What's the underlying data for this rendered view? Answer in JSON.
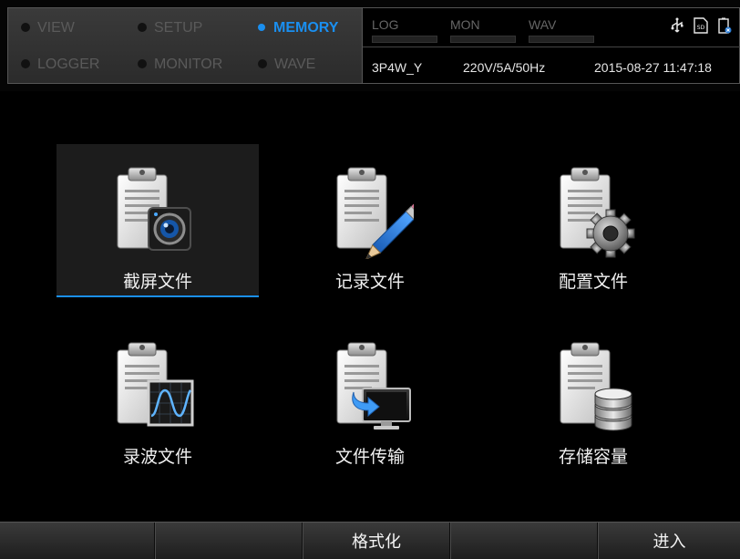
{
  "modes": {
    "view": "VIEW",
    "setup": "SETUP",
    "memory": "MEMORY",
    "logger": "LOGGER",
    "monitor": "MONITOR",
    "wave": "WAVE"
  },
  "meters": {
    "log": "LOG",
    "mon": "MON",
    "wav": "WAV"
  },
  "status": {
    "wiring": "3P4W_Y",
    "range": "220V/5A/50Hz",
    "datetime": "2015-08-27 11:47:18"
  },
  "system_icons": [
    "usb-icon",
    "sd-card-icon",
    "battery-charging-icon"
  ],
  "tiles": [
    {
      "label": "截屏文件",
      "icon": "screenshot-file-icon",
      "selected": true
    },
    {
      "label": "记录文件",
      "icon": "record-file-icon",
      "selected": false
    },
    {
      "label": "配置文件",
      "icon": "config-file-icon",
      "selected": false
    },
    {
      "label": "录波文件",
      "icon": "waveform-file-icon",
      "selected": false
    },
    {
      "label": "文件传输",
      "icon": "file-transfer-icon",
      "selected": false
    },
    {
      "label": "存储容量",
      "icon": "storage-capacity-icon",
      "selected": false
    }
  ],
  "softkeys": [
    "",
    "",
    "格式化",
    "",
    "进入"
  ],
  "colors": {
    "accent": "#1a8ff0",
    "inactive_text": "#5a5a5a",
    "background": "#000000"
  }
}
